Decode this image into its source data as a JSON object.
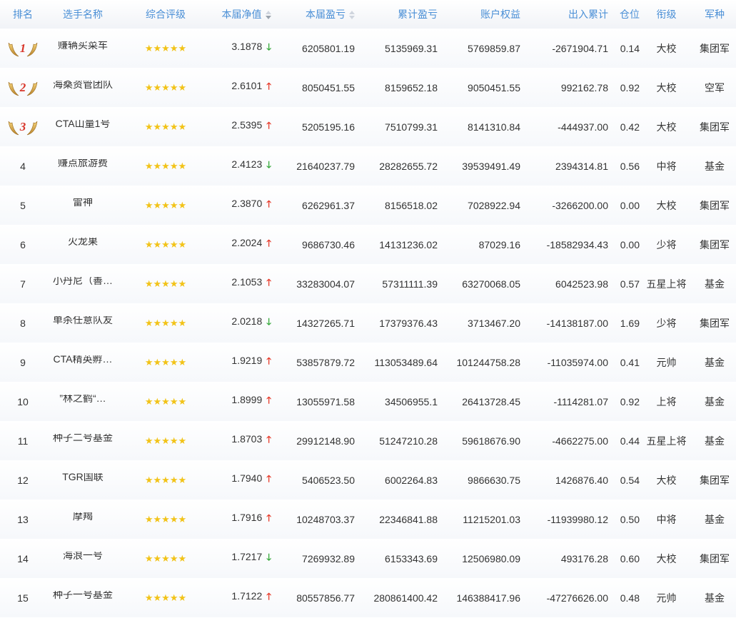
{
  "headers": {
    "rank": "排名",
    "name": "选手名称",
    "rating": "综合评级",
    "nav": "本届净值",
    "session_pnl": "本届盈亏",
    "cumulative_pnl": "累计盈亏",
    "equity": "账户权益",
    "inout": "出入累计",
    "position": "仓位",
    "title": "衔级",
    "army": "军种"
  },
  "stars": "★★★★★",
  "colors": {
    "header_text": "#4a8fd6",
    "star": "#f2c318",
    "up": "#e63a2a",
    "down": "#35a83a"
  },
  "rows": [
    {
      "rank": "1",
      "medal": true,
      "name": "赚辆买菜车",
      "nav": "3.1878",
      "trend": "down",
      "session": "6205801.19",
      "cum": "5135969.31",
      "equity": "5769859.87",
      "inout": "-2671904.71",
      "pos": "0.14",
      "title": "大校",
      "army": "集团军"
    },
    {
      "rank": "2",
      "medal": true,
      "name": "海桑资管团队",
      "nav": "2.6101",
      "trend": "up",
      "session": "8050451.55",
      "cum": "8159652.18",
      "equity": "9050451.55",
      "inout": "992162.78",
      "pos": "0.92",
      "title": "大校",
      "army": "空军"
    },
    {
      "rank": "3",
      "medal": true,
      "name": "CTA山量1号",
      "nav": "2.5395",
      "trend": "up",
      "session": "5205195.16",
      "cum": "7510799.31",
      "equity": "8141310.84",
      "inout": "-444937.00",
      "pos": "0.42",
      "title": "大校",
      "army": "集团军"
    },
    {
      "rank": "4",
      "medal": false,
      "name": "赚点旅游费",
      "nav": "2.4123",
      "trend": "down",
      "session": "21640237.79",
      "cum": "28282655.72",
      "equity": "39539491.49",
      "inout": "2394314.81",
      "pos": "0.56",
      "title": "中将",
      "army": "基金"
    },
    {
      "rank": "5",
      "medal": false,
      "name": "雷神",
      "nav": "2.3870",
      "trend": "up",
      "session": "6262961.37",
      "cum": "8156518.02",
      "equity": "7028922.94",
      "inout": "-3266200.00",
      "pos": "0.00",
      "title": "大校",
      "army": "集团军"
    },
    {
      "rank": "6",
      "medal": false,
      "name": "火龙果",
      "nav": "2.2024",
      "trend": "up",
      "session": "9686730.46",
      "cum": "14131236.02",
      "equity": "87029.16",
      "inout": "-18582934.43",
      "pos": "0.00",
      "title": "少将",
      "army": "集团军"
    },
    {
      "rank": "7",
      "medal": false,
      "name": "小丹尼（善…",
      "nav": "2.1053",
      "trend": "up",
      "session": "33283004.07",
      "cum": "57311111.39",
      "equity": "63270068.05",
      "inout": "6042523.98",
      "pos": "0.57",
      "title": "五星上将",
      "army": "基金"
    },
    {
      "rank": "8",
      "medal": false,
      "name": "单杀任意队友",
      "nav": "2.0218",
      "trend": "down",
      "session": "14327265.71",
      "cum": "17379376.43",
      "equity": "3713467.20",
      "inout": "-14138187.00",
      "pos": "1.69",
      "title": "少将",
      "army": "集团军"
    },
    {
      "rank": "9",
      "medal": false,
      "name": "CTA精英孵…",
      "nav": "1.9219",
      "trend": "up",
      "session": "53857879.72",
      "cum": "113053489.64",
      "equity": "101244758.28",
      "inout": "-11035974.00",
      "pos": "0.41",
      "title": "元帅",
      "army": "基金"
    },
    {
      "rank": "10",
      "medal": false,
      "name": "”林之鹤“…",
      "nav": "1.8999",
      "trend": "up",
      "session": "13055971.58",
      "cum": "34506955.1",
      "equity": "26413728.45",
      "inout": "-1114281.07",
      "pos": "0.92",
      "title": "上将",
      "army": "基金"
    },
    {
      "rank": "11",
      "medal": false,
      "name": "种子二号基金",
      "nav": "1.8703",
      "trend": "up",
      "session": "29912148.90",
      "cum": "51247210.28",
      "equity": "59618676.90",
      "inout": "-4662275.00",
      "pos": "0.44",
      "title": "五星上将",
      "army": "基金"
    },
    {
      "rank": "12",
      "medal": false,
      "name": "TGR国联",
      "nav": "1.7940",
      "trend": "up",
      "session": "5406523.50",
      "cum": "6002264.83",
      "equity": "9866630.75",
      "inout": "1426876.40",
      "pos": "0.54",
      "title": "大校",
      "army": "集团军"
    },
    {
      "rank": "13",
      "medal": false,
      "name": "摩羯",
      "nav": "1.7916",
      "trend": "up",
      "session": "10248703.37",
      "cum": "22346841.88",
      "equity": "11215201.03",
      "inout": "-11939980.12",
      "pos": "0.50",
      "title": "中将",
      "army": "基金"
    },
    {
      "rank": "14",
      "medal": false,
      "name": "海浪一号",
      "nav": "1.7217",
      "trend": "down",
      "session": "7269932.89",
      "cum": "6153343.69",
      "equity": "12506980.09",
      "inout": "493176.28",
      "pos": "0.60",
      "title": "大校",
      "army": "集团军"
    },
    {
      "rank": "15",
      "medal": false,
      "name": "种子一号基金",
      "nav": "1.7122",
      "trend": "up",
      "session": "80557856.77",
      "cum": "280861400.42",
      "equity": "146388417.96",
      "inout": "-47276626.00",
      "pos": "0.48",
      "title": "元帅",
      "army": "基金"
    }
  ]
}
